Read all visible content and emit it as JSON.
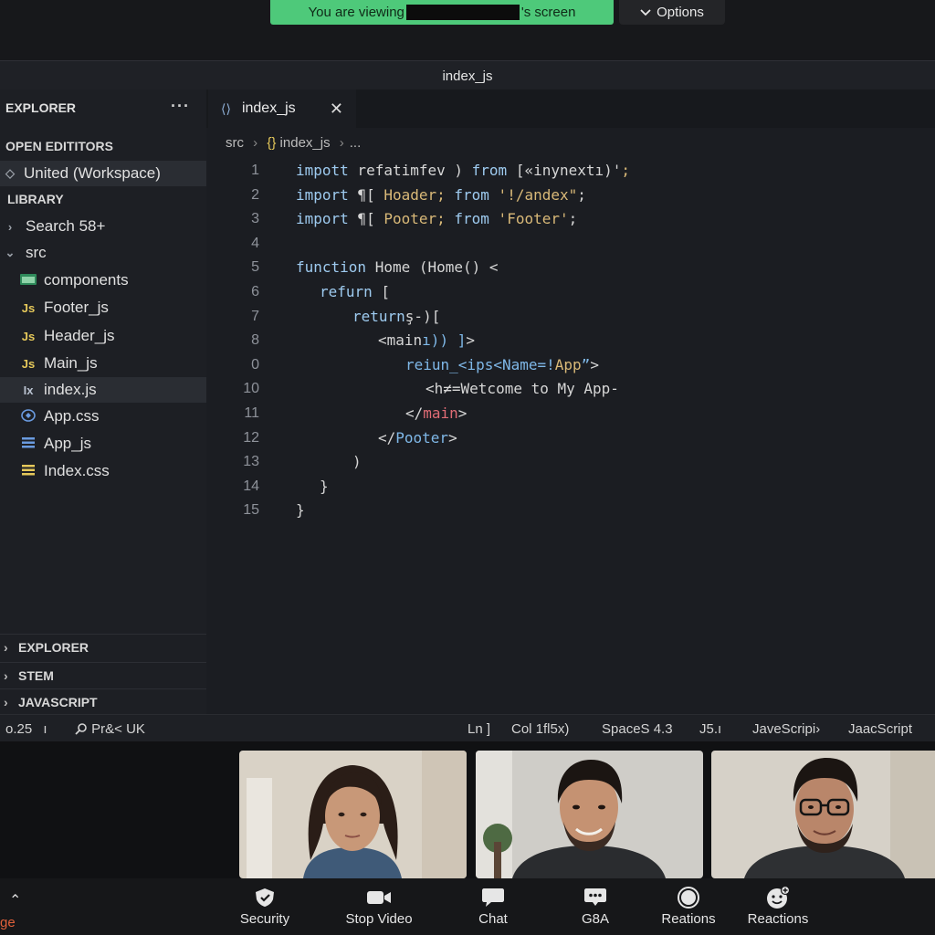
{
  "share": {
    "viewing_prefix": "You are viewing",
    "viewing_suffix": "'s screen",
    "options_label": "Options"
  },
  "window": {
    "title": "index_js"
  },
  "sidebar": {
    "explorer_label": "EXPLORER",
    "open_editors_label": "OPEN EDITITORS",
    "workspace_label": "United (Workspace)",
    "library_label": "LIBRARY",
    "search_label": "Search 58+",
    "src_label": "src",
    "files": [
      {
        "icon": "folder",
        "label": "components"
      },
      {
        "icon": "Js",
        "label": "Footer_js"
      },
      {
        "icon": "Js",
        "label": "Header_js"
      },
      {
        "icon": "Js",
        "label": "Main_js"
      },
      {
        "icon": "Ix",
        "label": "index.js"
      },
      {
        "icon": "css",
        "label": "App.css"
      },
      {
        "icon": "js-stack",
        "label": "App_js"
      },
      {
        "icon": "css-stack",
        "label": "Index.css"
      }
    ],
    "bottom_sections": [
      "EXPLORER",
      "STEM",
      "JAVASCRIPT"
    ]
  },
  "editor": {
    "tab_label": "index_js",
    "breadcrumb": {
      "root": "src",
      "file": "index_js",
      "tail": "..."
    },
    "lines": [
      {
        "n": "1",
        "indent": 0,
        "parts": [
          [
            "kw",
            "impott"
          ],
          [
            "plain",
            " refatimfev ) "
          ],
          [
            "kw",
            "from"
          ],
          [
            "plain",
            " [«inynextı)'"
          ],
          [
            "str",
            ";"
          ]
        ]
      },
      {
        "n": "2",
        "indent": 0,
        "parts": [
          [
            "kw",
            "import"
          ],
          [
            "plain",
            " ¶[ "
          ],
          [
            "str",
            "Hoader; "
          ],
          [
            "kw",
            "from"
          ],
          [
            "str",
            " '!/andex\""
          ],
          [
            "plain",
            ";"
          ]
        ]
      },
      {
        "n": "3",
        "indent": 0,
        "parts": [
          [
            "kw",
            "import"
          ],
          [
            "plain",
            " ¶[ "
          ],
          [
            "str",
            "Pooter; "
          ],
          [
            "kw",
            "from"
          ],
          [
            "str",
            " 'Footer'"
          ],
          [
            "plain",
            ";"
          ]
        ]
      },
      {
        "n": "4",
        "indent": 0,
        "parts": []
      },
      {
        "n": "5",
        "indent": 0,
        "parts": [
          [
            "kw",
            "function"
          ],
          [
            "plain",
            " Home "
          ],
          [
            "br",
            "(Home() <"
          ]
        ]
      },
      {
        "n": "6",
        "indent": 1,
        "parts": [
          [
            "kw",
            "refurn"
          ],
          [
            "plain",
            " ["
          ]
        ]
      },
      {
        "n": "7",
        "indent": 2,
        "parts": [
          [
            "kw",
            "return"
          ],
          [
            "plain",
            "ş-)["
          ]
        ]
      },
      {
        "n": "8",
        "indent": 3,
        "parts": [
          [
            "plain",
            "<main"
          ],
          [
            "attr",
            "ı)) ]"
          ],
          [
            "plain",
            ">"
          ]
        ]
      },
      {
        "n": "0",
        "indent": 4,
        "parts": [
          [
            "attr",
            "reiun_<ips<Name=!"
          ],
          [
            "str",
            "App"
          ],
          [
            "attr",
            "”"
          ],
          [
            "plain",
            ">"
          ]
        ]
      },
      {
        "n": "10",
        "indent": 5,
        "parts": [
          [
            "plain",
            "<h≠=Wetcome to My App-"
          ]
        ]
      },
      {
        "n": "11",
        "indent": 4,
        "parts": [
          [
            "plain",
            "</"
          ],
          [
            "tag",
            "main"
          ],
          [
            "plain",
            ">"
          ]
        ]
      },
      {
        "n": "12",
        "indent": 3,
        "parts": [
          [
            "plain",
            "</"
          ],
          [
            "attr",
            "Pooter"
          ],
          [
            "plain",
            ">"
          ]
        ]
      },
      {
        "n": "13",
        "indent": 2,
        "parts": [
          [
            "plain",
            ")"
          ]
        ]
      },
      {
        "n": "14",
        "indent": 1,
        "parts": [
          [
            "plain",
            "}"
          ]
        ]
      },
      {
        "n": "15",
        "indent": 0,
        "parts": [
          [
            "plain",
            "}"
          ]
        ]
      }
    ]
  },
  "statusbar": {
    "left1": "o.25",
    "left1_suffix": "ı",
    "left2": "Pr&< UK",
    "ln": "Ln ]",
    "col": "Col 1fl5x)",
    "spaces": "SpaceS 4.3",
    "enc": "J5.ı",
    "lang1": "JaveScripi›",
    "lang2": "JaacScript"
  },
  "participants": [
    {
      "name": "participant-woman"
    },
    {
      "name": "participant-man-smiling"
    },
    {
      "name": "participant-man-glasses"
    }
  ],
  "toolbar": {
    "security_label": "Security",
    "stop_video_label": "Stop Video",
    "chat_label": "Chat",
    "qa_label": "G8A",
    "reations_label": "Reations",
    "reactions_label": "Reactions",
    "edge_label": "ge"
  },
  "colors": {
    "share_green": "#4ec97a",
    "keyword": "#9ecbf0",
    "string": "#d9b978",
    "tag": "#e06c75"
  }
}
